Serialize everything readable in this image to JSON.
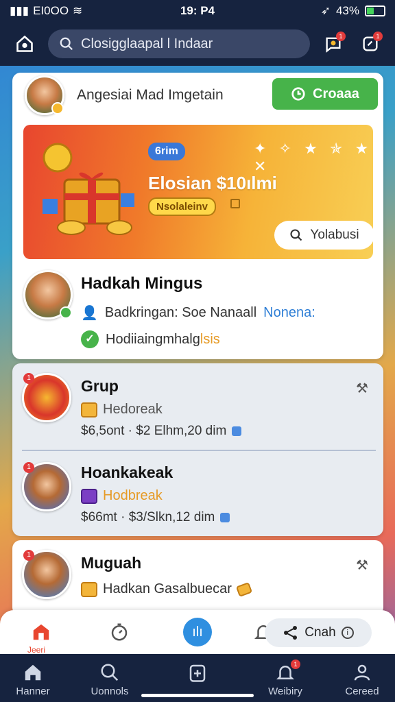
{
  "status_bar": {
    "carrier": "EI0OO",
    "time": "19: P4",
    "battery": "43%",
    "battery_level": 0.43
  },
  "top_bar": {
    "search_text": "Closigglaapal l Indaar",
    "notification_badges": [
      "1",
      "1"
    ]
  },
  "main_card": {
    "user_name": "Angesiai Mad Imgetain",
    "create_label": "Croaaa",
    "promo": {
      "tag": "6rim",
      "title": "Elosian $10ılmi",
      "chip": "Nsolaleinv",
      "search_label": "Yolabusi"
    },
    "profile": {
      "name": "Hadkah Mingus",
      "line1_prefix": "Badkringan: Soe Nanaall",
      "line1_accent": "Nonena:",
      "line2_prefix": "Hodiiaingmhalg",
      "line2_accent": "lsis"
    }
  },
  "list": [
    {
      "title": "Grup",
      "sub": "Hedoreak",
      "meta": "$6,5ont · $2 Elhm,20 dim",
      "badge": "1"
    },
    {
      "title": "Hoankakeak",
      "sub": "Hodbreak",
      "meta": "$66mt · $3/Slkn,12 dim",
      "badge": "1"
    },
    {
      "title": "Muguah",
      "sub": "Hadkan Gasalbuecar",
      "badge": "1"
    }
  ],
  "bottom_tabs": {
    "mesh_label": "Cnah",
    "tab_label": "Jeeri"
  },
  "bottom_nav": [
    {
      "label": "Hanner",
      "icon": "home-icon"
    },
    {
      "label": "Uonnols",
      "icon": "search-icon"
    },
    {
      "label": "",
      "icon": "plus-icon"
    },
    {
      "label": "Weibiry",
      "icon": "bell-icon",
      "badge": "1"
    },
    {
      "label": "Cereed",
      "icon": "user-icon"
    }
  ],
  "colors": {
    "nav_bg": "#16233f",
    "accent_green": "#47b34a",
    "accent_blue": "#2f8fe0",
    "badge_red": "#e23b3b"
  }
}
